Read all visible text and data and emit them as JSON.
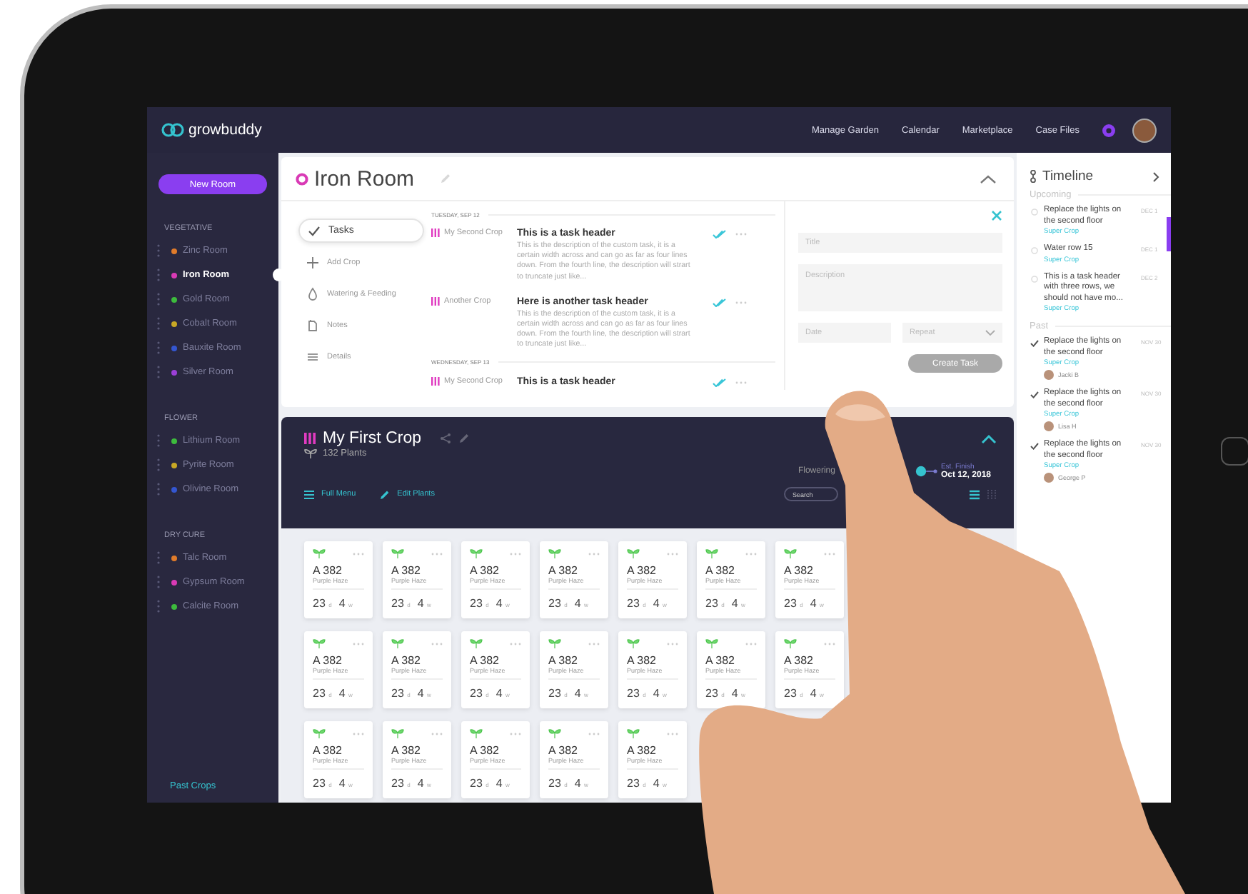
{
  "nav": {
    "logo": "growbuddy",
    "links": [
      "Manage Garden",
      "Calendar",
      "Marketplace",
      "Case Files"
    ]
  },
  "sidebar": {
    "new_room_button": "New Room",
    "sections": [
      {
        "title": "VEGETATIVE",
        "rooms": [
          {
            "name": "Zinc Room",
            "color": "#e07b2a",
            "selected": false
          },
          {
            "name": "Iron Room",
            "color": "#d93ab5",
            "selected": true
          },
          {
            "name": "Gold Room",
            "color": "#3dbb3d",
            "selected": false
          },
          {
            "name": "Cobalt Room",
            "color": "#c8a825",
            "selected": false
          },
          {
            "name": "Bauxite Room",
            "color": "#3456d0",
            "selected": false
          },
          {
            "name": "Silver Room",
            "color": "#9b3fd6",
            "selected": false
          }
        ]
      },
      {
        "title": "FLOWER",
        "rooms": [
          {
            "name": "Lithium Room",
            "color": "#3dbb3d",
            "selected": false
          },
          {
            "name": "Pyrite Room",
            "color": "#c8a825",
            "selected": false
          },
          {
            "name": "Olivine Room",
            "color": "#3456d0",
            "selected": false
          }
        ]
      },
      {
        "title": "DRY CURE",
        "rooms": [
          {
            "name": "Talc Room",
            "color": "#e07b2a",
            "selected": false
          },
          {
            "name": "Gypsum Room",
            "color": "#d93ab5",
            "selected": false
          },
          {
            "name": "Calcite Room",
            "color": "#3dbb3d",
            "selected": false
          }
        ]
      }
    ],
    "past_crops_link": "Past Crops"
  },
  "room": {
    "title": "Iron Room",
    "menu": [
      {
        "label": "Tasks",
        "selected": true
      },
      {
        "label": "Add Crop",
        "selected": false
      },
      {
        "label": "Watering & Feeding",
        "selected": false
      },
      {
        "label": "Notes",
        "selected": false
      },
      {
        "label": "Details",
        "selected": false
      }
    ],
    "task_groups": [
      {
        "date": "TUESDAY, SEP 12",
        "tasks": [
          {
            "crop": "My Second Crop",
            "header": "This is a task header",
            "description": "This is the description of the custom task, it is a certain width across and can go as far as four lines down. From the fourth line, the description will strart to truncate just like..."
          },
          {
            "crop": "Another Crop",
            "header": "Here is another task header",
            "description": "This is the description of the custom task, it is a certain width across and can go as far as four lines down. From the fourth line, the description will strart to truncate just like..."
          }
        ]
      },
      {
        "date": "WEDNESDAY, SEP 13",
        "tasks": [
          {
            "crop": "My Second Crop",
            "header": "This is a task header"
          }
        ]
      }
    ],
    "new_task_form": {
      "title": {
        "placeholder": "Title"
      },
      "description": {
        "placeholder": "Description"
      },
      "date": {
        "placeholder": "Date"
      },
      "repeat": {
        "placeholder": "Repeat"
      },
      "create_button": {
        "label": "Create Task",
        "disabled": true
      }
    }
  },
  "crop": {
    "title": "My First Crop",
    "plant_count": "132 Plants",
    "stage": "Flowering",
    "est_finish_label": "Est. Finish",
    "est_finish_date": "Oct 12, 2018",
    "actions": [
      "Full Menu",
      "Edit Plants"
    ],
    "search": {
      "placeholder": "Search"
    },
    "plants": [
      {
        "id": "A 382",
        "strain": "Purple Haze",
        "days": "23",
        "days_unit": "d",
        "weeks": "4",
        "weeks_unit": "w"
      },
      {
        "id": "A 382",
        "strain": "Purple Haze",
        "days": "23",
        "days_unit": "d",
        "weeks": "4",
        "weeks_unit": "w"
      },
      {
        "id": "A 382",
        "strain": "Purple Haze",
        "days": "23",
        "days_unit": "d",
        "weeks": "4",
        "weeks_unit": "w"
      },
      {
        "id": "A 382",
        "strain": "Purple Haze",
        "days": "23",
        "days_unit": "d",
        "weeks": "4",
        "weeks_unit": "w"
      },
      {
        "id": "A 382",
        "strain": "Purple Haze",
        "days": "23",
        "days_unit": "d",
        "weeks": "4",
        "weeks_unit": "w"
      },
      {
        "id": "A 382",
        "strain": "Purple Haze",
        "days": "23",
        "days_unit": "d",
        "weeks": "4",
        "weeks_unit": "w"
      },
      {
        "id": "A 382",
        "strain": "Purple Haze",
        "days": "23",
        "days_unit": "d",
        "weeks": "4",
        "weeks_unit": "w"
      },
      {
        "id": "A 382",
        "strain": "Purple Haze",
        "days": "23",
        "days_unit": "d",
        "weeks": "4",
        "weeks_unit": "w"
      },
      {
        "id": "A 382",
        "strain": "Purple Haze",
        "days": "23",
        "days_unit": "d",
        "weeks": "4",
        "weeks_unit": "w"
      },
      {
        "id": "A 382",
        "strain": "Purple Haze",
        "days": "23",
        "days_unit": "d",
        "weeks": "4",
        "weeks_unit": "w"
      },
      {
        "id": "A 382",
        "strain": "Purple Haze",
        "days": "23",
        "days_unit": "d",
        "weeks": "4",
        "weeks_unit": "w"
      },
      {
        "id": "A 382",
        "strain": "Purple Haze",
        "days": "23",
        "days_unit": "d",
        "weeks": "4",
        "weeks_unit": "w"
      },
      {
        "id": "A 382",
        "strain": "Purple Haze",
        "days": "23",
        "days_unit": "d",
        "weeks": "4",
        "weeks_unit": "w"
      },
      {
        "id": "A 382",
        "strain": "Purple Haze",
        "days": "23",
        "days_unit": "d",
        "weeks": "4",
        "weeks_unit": "w"
      },
      {
        "id": "A 382",
        "strain": "Purple Haze",
        "days": "23",
        "days_unit": "d",
        "weeks": "4",
        "weeks_unit": "w"
      },
      {
        "id": "A 382",
        "strain": "Purple Haze",
        "days": "23",
        "days_unit": "d",
        "weeks": "4",
        "weeks_unit": "w"
      },
      {
        "id": "A 382",
        "strain": "Purple Haze",
        "days": "23",
        "days_unit": "d",
        "weeks": "4",
        "weeks_unit": "w"
      },
      {
        "id": "A 382",
        "strain": "Purple Haze",
        "days": "23",
        "days_unit": "d",
        "weeks": "4",
        "weeks_unit": "w"
      },
      {
        "id": "A 382",
        "strain": "Purple Haze",
        "days": "23",
        "days_unit": "d",
        "weeks": "4",
        "weeks_unit": "w"
      }
    ]
  },
  "timeline": {
    "title": "Timeline",
    "sections": [
      {
        "label": "Upcoming",
        "items": [
          {
            "title": "Replace the lights on the second floor",
            "crop": "Super Crop",
            "date": "DEC 1",
            "done": false
          },
          {
            "title": "Water row 15",
            "crop": "Super Crop",
            "date": "DEC 1",
            "done": false
          },
          {
            "title": "This is a task header with three rows, we should not have mo...",
            "crop": "Super Crop",
            "date": "DEC 2",
            "done": false
          }
        ]
      },
      {
        "label": "Past",
        "items": [
          {
            "title": "Replace the lights on the second floor",
            "crop": "Super Crop",
            "user": "Jacki B",
            "date": "NOV 30",
            "done": true
          },
          {
            "title": "Replace the lights on the second floor",
            "crop": "Super Crop",
            "user": "Lisa H",
            "date": "NOV 30",
            "done": true
          },
          {
            "title": "Replace the lights on the second floor",
            "crop": "Super Crop",
            "user": "George P",
            "date": "NOV 30",
            "done": true
          }
        ]
      }
    ]
  }
}
